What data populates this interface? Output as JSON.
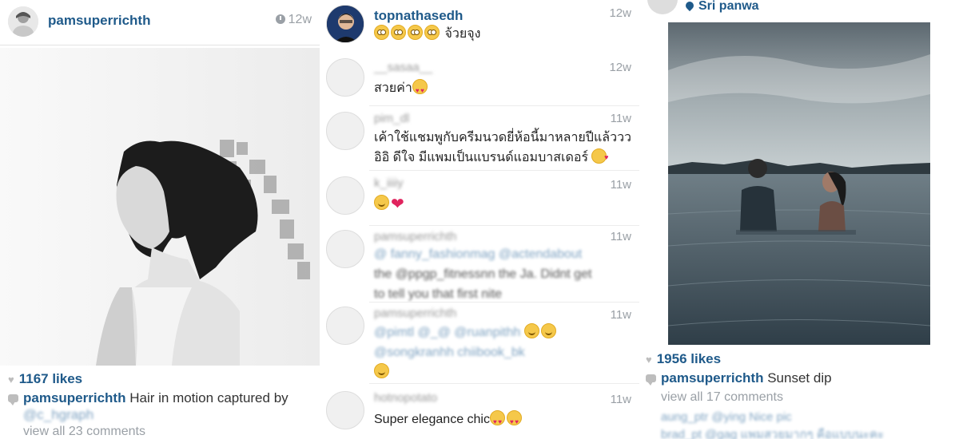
{
  "left_post": {
    "username": "pamsuperrichth",
    "time": "12w",
    "likes": "1167 likes",
    "caption_user": "pamsuperrichth",
    "caption_text": "Hair in motion captured by",
    "caption_mention": "@c_hgraph",
    "view_all": "view all 23 comments"
  },
  "middle_comments": [
    {
      "user": "topnathasedh",
      "time": "12w",
      "text": "จ้วยจุง",
      "emoji": [
        "flushed",
        "flushed",
        "flushed",
        "flushed"
      ]
    },
    {
      "user": "__sasaa__",
      "time": "12w",
      "text": "สวยค่า",
      "emoji": [
        "hearteyes"
      ]
    },
    {
      "user": "pim_dl",
      "time": "11w",
      "text": "เค้าใช้แชมพูกับครีมนวดยี่ห้อนี้มาหลายปีแล้ววว อิอิ ดีใจ มีแพมเป็นแบรนด์แอมบาสเดอร์",
      "emoji": [
        "kiss"
      ]
    },
    {
      "user": "k_iiiiy",
      "time": "11w",
      "text": "",
      "emoji": [
        "smile"
      ],
      "heart": "❤"
    },
    {
      "user": "pamsuperrichth",
      "time": "11w",
      "text_mention": "@ fanny_fashionmag @actendabout",
      "text_line2": "the @ppgp_fitnessnn the Ja. Didnt get",
      "text_line3": "to tell you that first nite"
    },
    {
      "user": "pamsuperrichth",
      "time": "11w",
      "text_mention": "@pimtl @_@ @ruanpithh",
      "text_line2": "@songkranhh chiibook_bk",
      "emoji": [
        "smile",
        "smile",
        "smile"
      ]
    },
    {
      "user": "hotnopotato",
      "time": "11w",
      "text": "Super elegance chic",
      "emoji": [
        "hearteyes",
        "hearteyes"
      ]
    }
  ],
  "right_post": {
    "location": "Sri panwa",
    "likes": "1956 likes",
    "caption_user": "pamsuperrichth",
    "caption_text": "Sunset dip",
    "view_all": "view all 17 comments",
    "comment1": "aung_ptr @ying Nice pic",
    "comment2": "brad_pt @gag แพมสวยมากๆ คือแบบนะคะ"
  }
}
